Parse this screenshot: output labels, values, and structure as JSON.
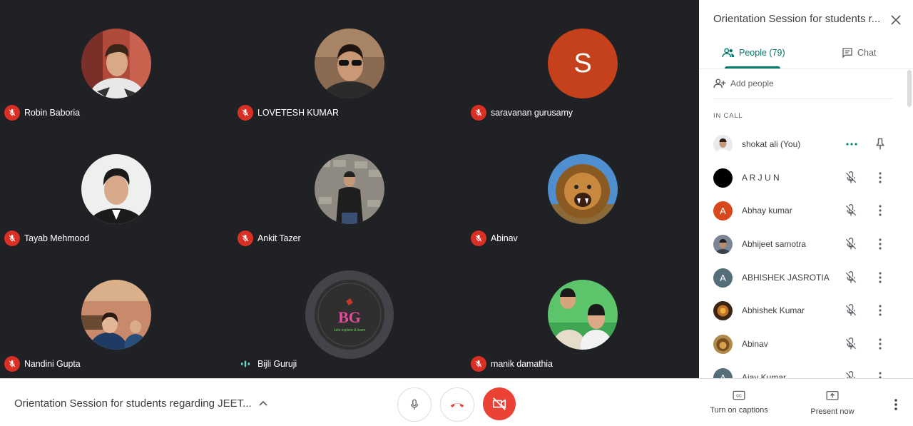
{
  "meeting": {
    "title": "Orientation Session for students regarding JEET...",
    "panel_title": "Orientation Session for students r..."
  },
  "tiles": [
    {
      "name": "Robin Baboria",
      "muted": true
    },
    {
      "name": "LOVETESH KUMAR",
      "muted": true
    },
    {
      "name": "saravanan gurusamy",
      "muted": true,
      "initial": "S"
    },
    {
      "name": "Tayab Mehmood",
      "muted": true
    },
    {
      "name": "Ankit Tazer",
      "muted": true
    },
    {
      "name": "Abinav",
      "muted": true
    },
    {
      "name": "Nandini Gupta",
      "muted": true
    },
    {
      "name": "Bijli Guruji",
      "muted": false,
      "speaking": true,
      "logo_text": "BG",
      "logo_tagline": "Lets explore & learn"
    },
    {
      "name": "manik damathia",
      "muted": true
    }
  ],
  "panel": {
    "tabs": {
      "people": "People (79)",
      "chat": "Chat"
    },
    "add_people": "Add people",
    "section": "IN CALL",
    "people": [
      {
        "name": "shokat ali (You)",
        "self": true
      },
      {
        "name": "A R J U N"
      },
      {
        "name": "Abhay kumar",
        "initial": "A"
      },
      {
        "name": "Abhijeet samotra"
      },
      {
        "name": "ABHISHEK JASROTIA",
        "initial": "A"
      },
      {
        "name": "Abhishek Kumar"
      },
      {
        "name": "Abinav"
      },
      {
        "name": "Ajay Kumar",
        "initial": "A"
      }
    ]
  },
  "controls": {
    "captions": "Turn on captions",
    "present": "Present now"
  },
  "colors": {
    "stage_bg": "#202124",
    "accent": "#00796b",
    "danger": "#ea4335",
    "muted_badge": "#d93025"
  }
}
